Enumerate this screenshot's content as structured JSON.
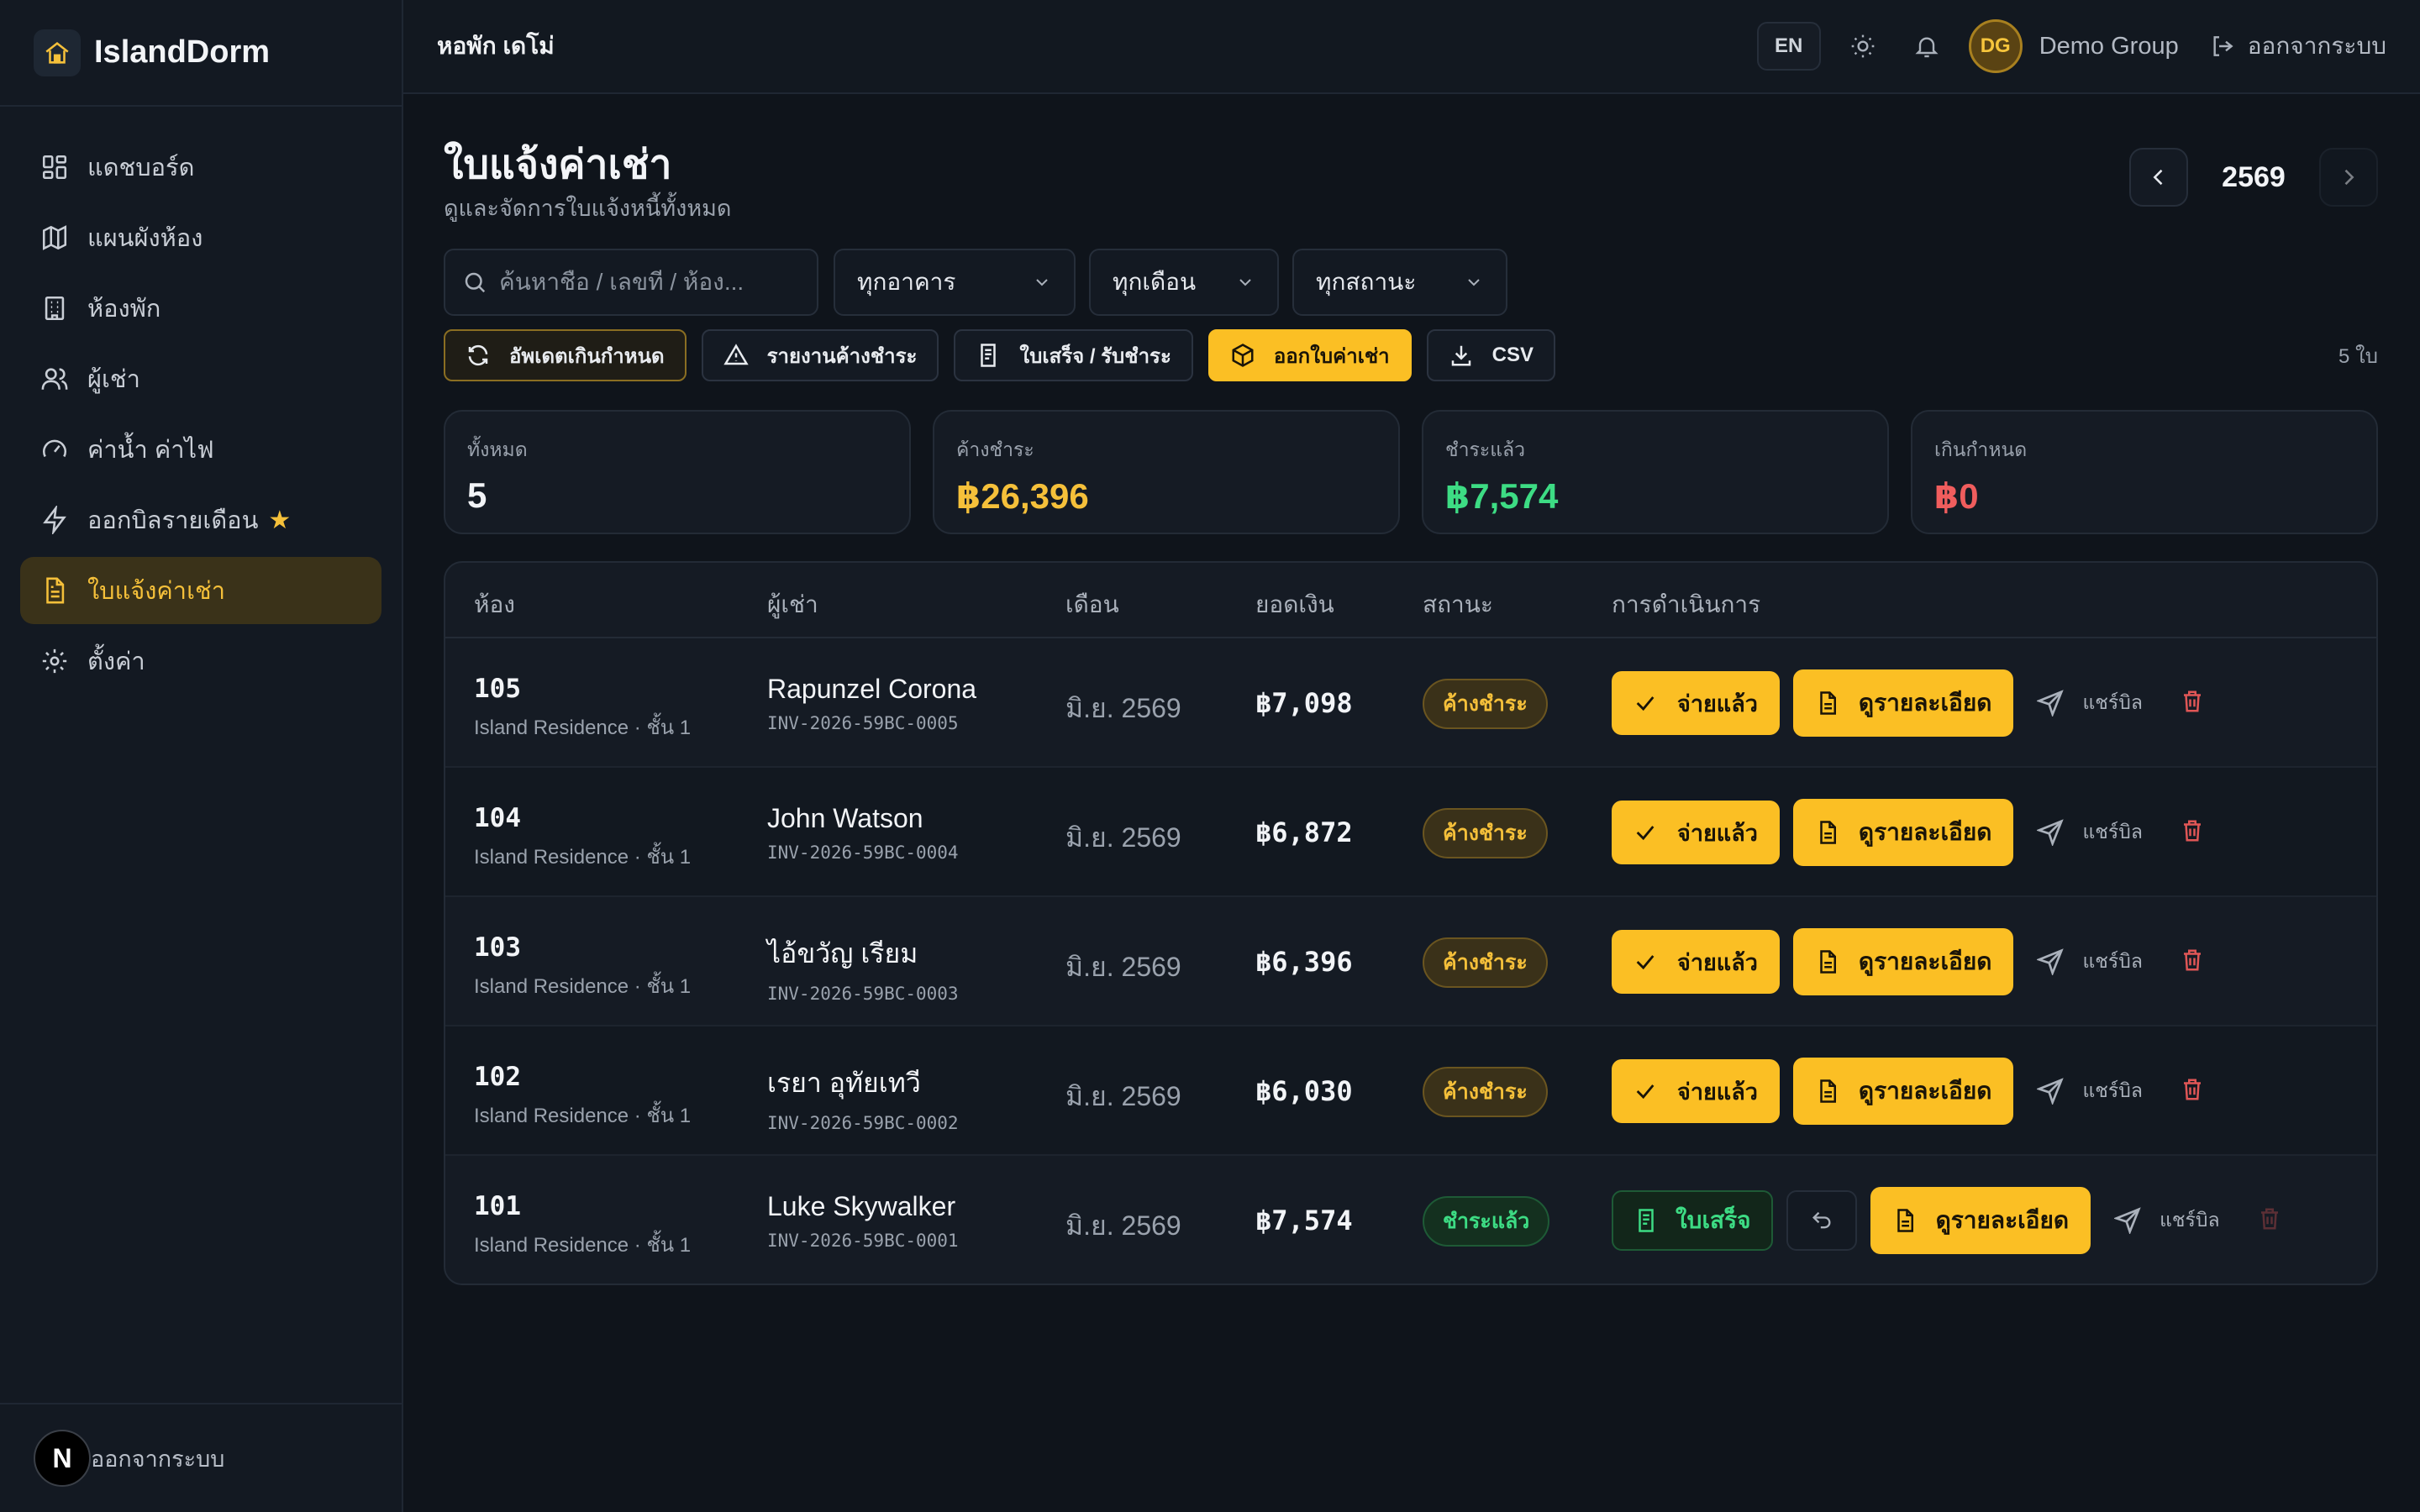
{
  "app": {
    "brand": "IslandDorm",
    "dorm_name": "หอพัก เดโม่"
  },
  "topbar": {
    "lang": "EN",
    "avatar_initials": "DG",
    "user_name": "Demo Group",
    "logout": "ออกจากระบบ"
  },
  "sidebar": {
    "items": [
      {
        "label": "แดชบอร์ด",
        "icon": "dashboard-icon"
      },
      {
        "label": "แผนผังห้อง",
        "icon": "map-icon"
      },
      {
        "label": "ห้องพัก",
        "icon": "building-icon"
      },
      {
        "label": "ผู้เช่า",
        "icon": "users-icon"
      },
      {
        "label": "ค่าน้ำ ค่าไฟ",
        "icon": "gauge-icon"
      },
      {
        "label": "ออกบิลรายเดือน",
        "icon": "lightning-icon"
      },
      {
        "label": "ใบแจ้งค่าเช่า",
        "icon": "document-icon"
      },
      {
        "label": "ตั้งค่า",
        "icon": "gear-icon"
      }
    ],
    "active_index": 6,
    "badge": "N",
    "logout": "ออกจากระบบ"
  },
  "page": {
    "title": "ใบแจ้งค่าเช่า",
    "subtitle": "ดูและจัดการใบแจ้งหนี้ทั้งหมด",
    "year": "2569"
  },
  "filters": {
    "search_placeholder": "ค้นหาชื่อ / เลขที่ / ห้อง...",
    "building": "ทุกอาคาร",
    "month": "ทุกเดือน",
    "status": "ทุกสถานะ"
  },
  "actions": {
    "update_overdue": "อัพเดตเกินกำหนด",
    "arrears_report": "รายงานค้างชำระ",
    "receipts": "ใบเสร็จ / รับชำระ",
    "issue_invoice": "ออกใบค่าเช่า",
    "csv": "CSV",
    "count": "5 ใบ"
  },
  "stats": [
    {
      "label": "ทั้งหมด",
      "value": "5",
      "color": "#f2f4f7"
    },
    {
      "label": "ค้างชำระ",
      "value": "฿26,396",
      "color": "#f5c03a"
    },
    {
      "label": "ชำระแล้ว",
      "value": "฿7,574",
      "color": "#3ddc84"
    },
    {
      "label": "เกินกำหนด",
      "value": "฿0",
      "color": "#f05d5d"
    }
  ],
  "table": {
    "headers": {
      "room": "ห้อง",
      "tenant": "ผู้เช่า",
      "month": "เดือน",
      "amount": "ยอดเงิน",
      "status": "สถานะ",
      "actions": "การดำเนินการ"
    },
    "rows": [
      {
        "room": "105",
        "location": "Island Residence · ชั้น 1",
        "tenant": "Rapunzel Corona",
        "invoice": "INV-2026-59BC-0005",
        "month": "มิ.ย. 2569",
        "amount": "฿7,098",
        "status": "ค้างชำระ"
      },
      {
        "room": "104",
        "location": "Island Residence · ชั้น 1",
        "tenant": "John Watson",
        "invoice": "INV-2026-59BC-0004",
        "month": "มิ.ย. 2569",
        "amount": "฿6,872",
        "status": "ค้างชำระ"
      },
      {
        "room": "103",
        "location": "Island Residence · ชั้น 1",
        "tenant": "ไอ้ขวัญ เรียม",
        "invoice": "INV-2026-59BC-0003",
        "month": "มิ.ย. 2569",
        "amount": "฿6,396",
        "status": "ค้างชำระ"
      },
      {
        "room": "102",
        "location": "Island Residence · ชั้น 1",
        "tenant": "เรยา อุทัยเทวี",
        "invoice": "INV-2026-59BC-0002",
        "month": "มิ.ย. 2569",
        "amount": "฿6,030",
        "status": "ค้างชำระ"
      },
      {
        "room": "101",
        "location": "Island Residence · ชั้น 1",
        "tenant": "Luke Skywalker",
        "invoice": "INV-2026-59BC-0001",
        "month": "มิ.ย. 2569",
        "amount": "฿7,574",
        "status": "ชำระแล้ว"
      }
    ],
    "btn_paid": "จ่ายแล้ว",
    "btn_detail": "ดูรายละเอียด",
    "btn_share": "แชร์บิล",
    "btn_receipt": "ใบเสร็จ"
  },
  "colors": {
    "accent": "#fbbf24",
    "paid": "#3ddc84",
    "danger": "#f05d5d"
  }
}
